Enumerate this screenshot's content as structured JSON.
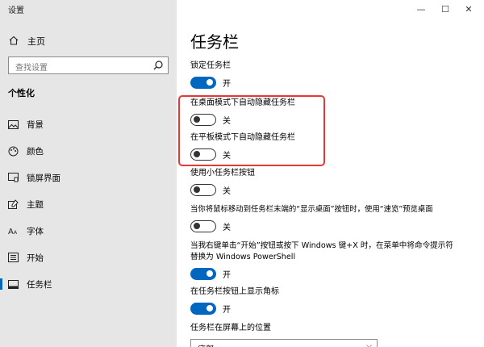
{
  "app": {
    "title": "设置"
  },
  "window_controls": {
    "minimize": "—",
    "maximize": "☐",
    "close": "✕"
  },
  "sidebar": {
    "home_label": "主页",
    "search_placeholder": "查找设置",
    "section_title": "个性化",
    "items": [
      {
        "label": "背景",
        "icon": "picture-icon"
      },
      {
        "label": "颜色",
        "icon": "palette-icon"
      },
      {
        "label": "锁屏界面",
        "icon": "lock-screen-icon"
      },
      {
        "label": "主题",
        "icon": "theme-icon"
      },
      {
        "label": "字体",
        "icon": "font-icon"
      },
      {
        "label": "开始",
        "icon": "start-icon"
      },
      {
        "label": "任务栏",
        "icon": "taskbar-icon",
        "active": true
      }
    ]
  },
  "main": {
    "title": "任务栏",
    "settings": [
      {
        "label": "锁定任务栏",
        "state": "开",
        "on": true
      },
      {
        "label": "在桌面模式下自动隐藏任务栏",
        "state": "关",
        "on": false
      },
      {
        "label": "在平板模式下自动隐藏任务栏",
        "state": "关",
        "on": false
      },
      {
        "label": "使用小任务栏按钮",
        "state": "关",
        "on": false
      },
      {
        "label": "当你将鼠标移动到任务栏末端的“显示桌面”按钮时，使用“速览”预览桌面",
        "state": "关",
        "on": false
      },
      {
        "label": "当我右键单击“开始”按钮或按下 Windows 键+X 时，在菜单中将命令提示符替换为 Windows PowerShell",
        "state": "开",
        "on": true
      },
      {
        "label": "在任务栏按钮上显示角标",
        "state": "开",
        "on": true
      }
    ],
    "position_label": "任务栏在屏幕上的位置",
    "position_value": "底部"
  },
  "colors": {
    "accent": "#0067c0",
    "highlight": "#e53935",
    "sidebar_bg": "#e6e6e6"
  }
}
